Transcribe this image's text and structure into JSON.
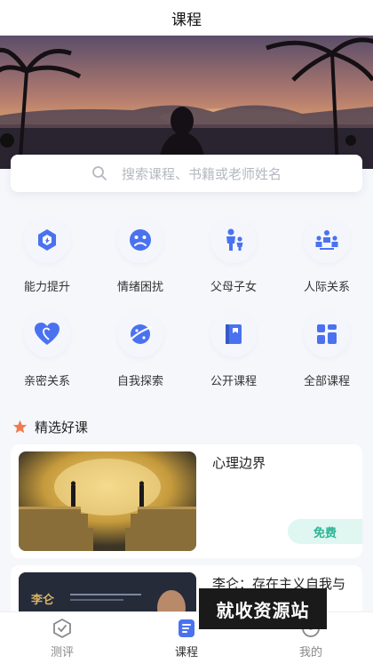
{
  "header": {
    "title": "课程"
  },
  "search": {
    "placeholder": "搜索课程、书籍或老师姓名",
    "icon": "search-icon"
  },
  "categories": [
    {
      "label": "能力提升",
      "icon": "ability-icon"
    },
    {
      "label": "情绪困扰",
      "icon": "emotion-icon"
    },
    {
      "label": "父母子女",
      "icon": "parent-child-icon"
    },
    {
      "label": "人际关系",
      "icon": "people-icon"
    },
    {
      "label": "亲密关系",
      "icon": "heart-icon"
    },
    {
      "label": "自我探索",
      "icon": "planet-icon"
    },
    {
      "label": "公开课程",
      "icon": "book-icon"
    },
    {
      "label": "全部课程",
      "icon": "grid-icon"
    }
  ],
  "section": {
    "title": "精选好课",
    "icon": "star-icon"
  },
  "courses": [
    {
      "title": "心理边界",
      "badge": "免费"
    },
    {
      "title": "李仑：存在主义自我与",
      "thumb_text": "李仑"
    }
  ],
  "watermark": "就收资源站",
  "tabs": [
    {
      "label": "测评",
      "icon": "assessment-icon"
    },
    {
      "label": "课程",
      "icon": "course-icon",
      "active": true
    },
    {
      "label": "我的",
      "icon": "profile-icon"
    }
  ],
  "colors": {
    "accent": "#4a72f0",
    "free_bg": "#dff6f1",
    "free_text": "#2ab596",
    "star": "#f07a4e"
  }
}
